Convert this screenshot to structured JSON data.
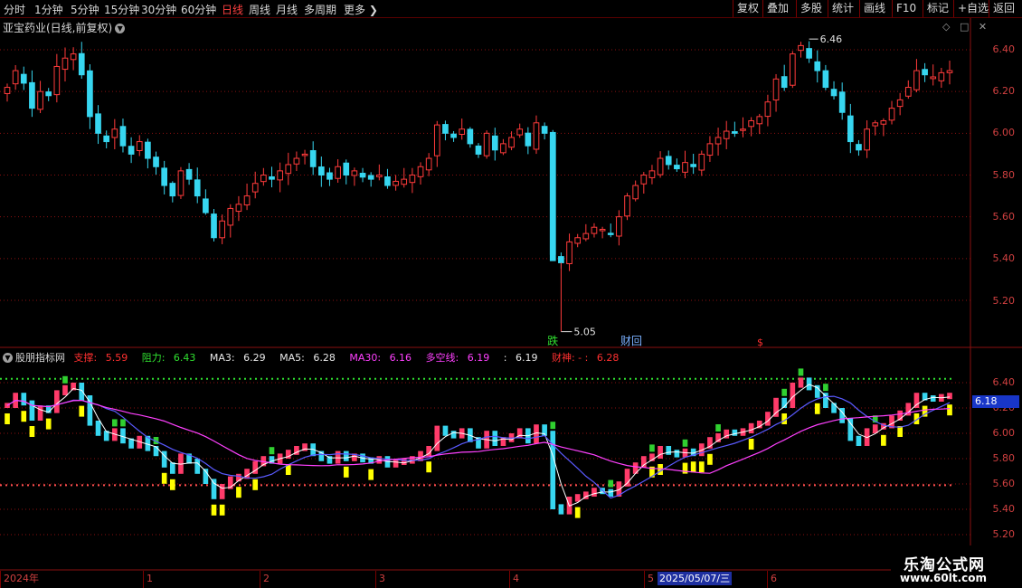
{
  "toolbar": {
    "periods": [
      "分时",
      "1分钟",
      "5分钟",
      "15分钟",
      "30分钟",
      "60分钟",
      "日线",
      "周线",
      "月线",
      "多周期",
      "更多"
    ],
    "active_period": "日线",
    "tools": [
      "复权",
      "叠加",
      "多股",
      "统计",
      "画线",
      "F10",
      "标记",
      "+自选",
      "返回"
    ]
  },
  "chart_title": "亚宝药业(日线,前复权)",
  "main_axis_labels": [
    "6.40",
    "6.20",
    "6.00",
    "5.80",
    "5.60",
    "5.40",
    "5.20"
  ],
  "annotations": {
    "high": "6.46",
    "low": "5.05",
    "signal_die": "跌",
    "signal_caihui": "财回",
    "signal_dollar": "$"
  },
  "indicator": {
    "name": "股朋指标网",
    "items": [
      {
        "label": "支撑: ",
        "value": "5.59",
        "color": "#ff3030"
      },
      {
        "label": "阻力: ",
        "value": "6.43",
        "color": "#30e030"
      },
      {
        "label": "MA3: ",
        "value": "6.29",
        "color": "#e8e8e8"
      },
      {
        "label": "MA5: ",
        "value": "6.28",
        "color": "#e8e8e8"
      },
      {
        "label": "MA30: ",
        "value": "6.16",
        "color": "#ff40ff"
      },
      {
        "label": "多空线: ",
        "value": "6.19",
        "color": "#ff40ff"
      },
      {
        "label": ": ",
        "value": "6.19",
        "color": "#e8e8e8"
      },
      {
        "label": "财神: - : ",
        "value": "6.28",
        "color": "#ff3030"
      }
    ],
    "axis_labels": [
      "6.40",
      "6.20",
      "6.00",
      "5.80",
      "5.60",
      "5.40",
      "5.20"
    ],
    "current_value": "6.18",
    "support": 5.59,
    "resistance": 6.43
  },
  "dates": {
    "labels": [
      {
        "text": "2024年"
      },
      {
        "text": "1"
      },
      {
        "text": "2"
      },
      {
        "text": "3"
      },
      {
        "text": "4"
      },
      {
        "text": "5"
      },
      {
        "text": "6"
      }
    ],
    "highlight": "2025/05/07/三"
  },
  "watermark": {
    "name": "乐淘公式网",
    "url": "www.60lt.com"
  },
  "colors": {
    "up": "#ff3b3b",
    "down": "#37d6f0",
    "grid": "#8a1010",
    "ma30": "#ff40ff",
    "ma_short": "#ffffff",
    "ma_long": "#5a5aff",
    "support": "#ff5050",
    "resistance": "#30e030"
  },
  "chart_data": {
    "type": "candlestick",
    "title": "亚宝药业(日线,前复权)",
    "ylim": [
      5.1,
      6.55
    ],
    "period_high": 6.46,
    "period_low": 5.05,
    "closes": [
      6.22,
      6.3,
      6.24,
      6.12,
      6.2,
      6.18,
      6.32,
      6.36,
      6.38,
      6.28,
      6.08,
      6.0,
      5.96,
      6.02,
      5.94,
      5.9,
      5.96,
      5.88,
      5.84,
      5.75,
      5.7,
      5.82,
      5.78,
      5.7,
      5.62,
      5.5,
      5.58,
      5.64,
      5.66,
      5.7,
      5.76,
      5.8,
      5.78,
      5.82,
      5.85,
      5.88,
      5.9,
      5.84,
      5.8,
      5.78,
      5.84,
      5.8,
      5.82,
      5.79,
      5.78,
      5.8,
      5.75,
      5.77,
      5.78,
      5.8,
      5.84,
      5.88,
      6.04,
      6.0,
      5.98,
      6.02,
      5.95,
      5.9,
      6.0,
      5.92,
      5.95,
      5.98,
      6.02,
      5.94,
      6.05,
      6.0,
      5.42,
      5.38,
      5.48,
      5.5,
      5.52,
      5.55,
      5.54,
      5.52,
      5.6,
      5.7,
      5.75,
      5.8,
      5.82,
      5.88,
      5.85,
      5.83,
      5.86,
      5.84,
      5.9,
      5.95,
      5.98,
      6.01,
      6.0,
      6.02,
      6.06,
      6.08,
      6.15,
      6.26,
      6.22,
      6.38,
      6.42,
      6.36,
      6.3,
      6.22,
      6.18,
      6.1,
      5.96,
      5.92,
      6.02,
      6.05,
      6.06,
      6.12,
      6.16,
      6.22,
      6.3,
      6.28,
      6.27,
      6.29,
      6.3
    ]
  }
}
